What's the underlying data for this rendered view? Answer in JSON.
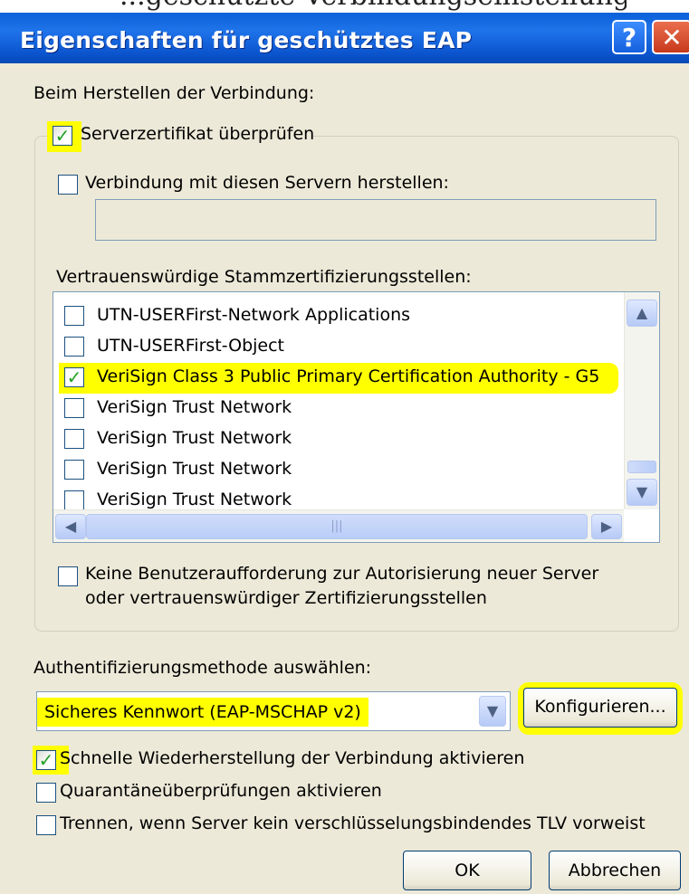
{
  "caption_cropped": "...geschützte Verbindungseinstellungen",
  "window": {
    "title": "Eigenschaften für geschütztes EAP",
    "help_label": "?",
    "close_label": "✕"
  },
  "section_connect": "Beim Herstellen der Verbindung:",
  "verify_cert": {
    "label": "Serverzertifikat überprüfen",
    "checked": true
  },
  "connect_servers": {
    "label": "Verbindung mit diesen Servern herstellen:",
    "checked": false,
    "value": ""
  },
  "trusted_ca_label": "Vertrauenswürdige Stammzertifizierungsstellen:",
  "ca_list": [
    {
      "name": "UTN-USERFirst-Network Applications",
      "checked": false
    },
    {
      "name": "UTN-USERFirst-Object",
      "checked": false
    },
    {
      "name": "VeriSign Class 3 Public Primary Certification Authority - G5",
      "checked": true
    },
    {
      "name": "VeriSign Trust Network",
      "checked": false
    },
    {
      "name": "VeriSign Trust Network",
      "checked": false
    },
    {
      "name": "VeriSign Trust Network",
      "checked": false
    },
    {
      "name": "VeriSign Trust Network",
      "checked": false
    }
  ],
  "no_prompt": {
    "line1": "Keine Benutzeraufforderung zur Autorisierung neuer Server",
    "line2": "oder vertrauenswürdiger Zertifizierungsstellen",
    "checked": false
  },
  "auth_method_label": "Authentifizierungsmethode auswählen:",
  "auth_method": {
    "selected": "Sicheres Kennwort (EAP-MSCHAP v2)"
  },
  "configure_button": "Konfigurieren...",
  "fast_reconnect": {
    "label": "Schnelle Wiederherstellung der Verbindung aktivieren",
    "checked": true
  },
  "quarantine": {
    "label": "Quarantäneüberprüfungen aktivieren",
    "checked": false
  },
  "disconnect_tlv": {
    "label": "Trennen, wenn Server kein verschlüsselungsbindendes TLV vorweist",
    "checked": false
  },
  "ok_button": "OK",
  "cancel_button": "Abbrechen",
  "colors": {
    "titlebar": "#0a5fd8",
    "dialog_bg": "#ece9d8",
    "highlight": "#ffff00",
    "check": "#21a121"
  }
}
